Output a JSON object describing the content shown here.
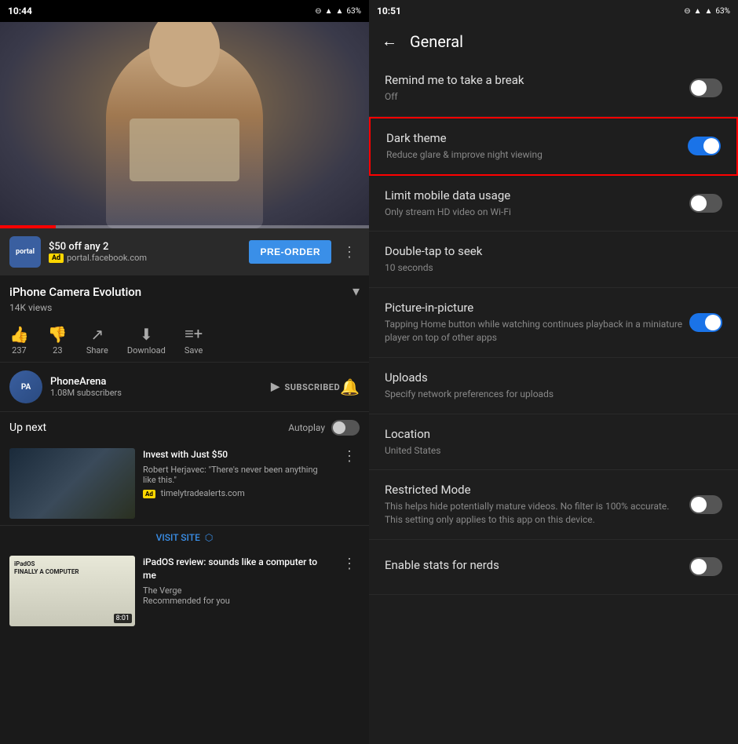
{
  "left": {
    "status_bar": {
      "time": "10:44",
      "icons": "▣ 📱 🐦 🐦 •",
      "right_icons": "⊖ ▲▲ 📶 63%"
    },
    "ad": {
      "price_text": "$50 off any 2",
      "badge": "Ad",
      "url": "portal.facebook.com",
      "preorder_label": "PRE-ORDER"
    },
    "video": {
      "title": "iPhone Camera Evolution",
      "views": "14K views",
      "like_count": "237",
      "dislike_count": "23",
      "share_label": "Share",
      "download_label": "Download",
      "save_label": "Save"
    },
    "channel": {
      "name": "PhoneArena",
      "subscribers": "1.08M subscribers",
      "subscribed_label": "SUBSCRIBED"
    },
    "up_next": {
      "label": "Up next",
      "autoplay_label": "Autoplay"
    },
    "cards": [
      {
        "title": "Invest with Just $50",
        "author": "Robert Herjavec: \"There's never been anything like this.\"",
        "ad_badge": "Ad",
        "ad_url": "timelytradealerts.com",
        "visit_site": "VISIT SITE"
      },
      {
        "title": "iPadOS review: sounds like a computer to me",
        "source": "The Verge",
        "rec": "Recommended for you",
        "duration": "8:01",
        "thumb_label": "iPadOS\nFINALLY A COMPUTER"
      }
    ]
  },
  "right": {
    "status_bar": {
      "time": "10:51",
      "icons": "▣ 📱 🐦 📧 •",
      "right_icons": "⊖ ▲▲ 📶 63%"
    },
    "header": {
      "back_icon": "←",
      "title": "General"
    },
    "settings": [
      {
        "id": "remind_break",
        "title": "Remind me to take a break",
        "subtitle": "Off",
        "toggle": "off",
        "highlighted": false
      },
      {
        "id": "dark_theme",
        "title": "Dark theme",
        "subtitle": "Reduce glare & improve night viewing",
        "toggle": "on",
        "highlighted": true
      },
      {
        "id": "limit_data",
        "title": "Limit mobile data usage",
        "subtitle": "Only stream HD video on Wi-Fi",
        "toggle": "off",
        "highlighted": false
      },
      {
        "id": "double_tap",
        "title": "Double-tap to seek",
        "subtitle": "10 seconds",
        "toggle": null,
        "highlighted": false
      },
      {
        "id": "pip",
        "title": "Picture-in-picture",
        "subtitle": "Tapping Home button while watching continues playback in a miniature player on top of other apps",
        "toggle": "on",
        "highlighted": false
      },
      {
        "id": "uploads",
        "title": "Uploads",
        "subtitle": "Specify network preferences for uploads",
        "toggle": null,
        "highlighted": false
      },
      {
        "id": "location",
        "title": "Location",
        "subtitle": "United States",
        "toggle": null,
        "highlighted": false
      },
      {
        "id": "restricted",
        "title": "Restricted Mode",
        "subtitle": "This helps hide potentially mature videos. No filter is 100% accurate. This setting only applies to this app on this device.",
        "toggle": "off",
        "highlighted": false
      },
      {
        "id": "stats",
        "title": "Enable stats for nerds",
        "subtitle": "",
        "toggle": "off",
        "highlighted": false
      }
    ]
  }
}
